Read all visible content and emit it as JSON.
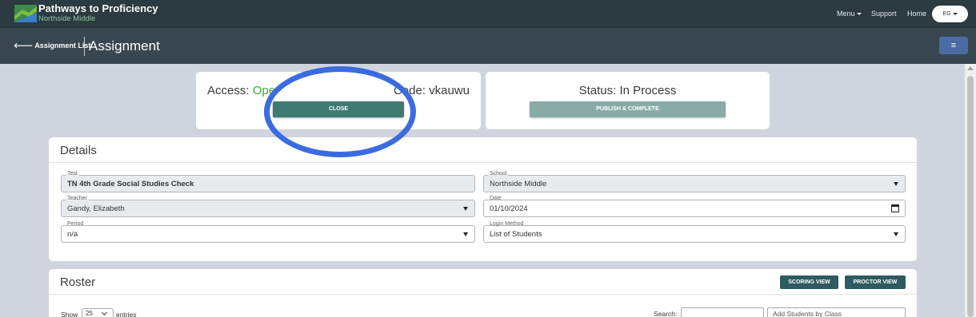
{
  "brand": {
    "title": "Pathways to Proficiency",
    "subtitle": "Northside Middle"
  },
  "topnav": {
    "menu": "Menu",
    "support": "Support",
    "home": "Home",
    "user_initials": "EG"
  },
  "subheader": {
    "back_label": "Assignment List",
    "page_title": "Assignment",
    "menu_icon": "≡"
  },
  "access_card": {
    "access_prefix": "Access: ",
    "access_value": "Ope",
    "code_prefix": "Code: ",
    "code_value": "vkauwu",
    "close_button": "CLOSE"
  },
  "status_card": {
    "status": "Status: In Process",
    "publish_button": "PUBLISH & COMPLETE"
  },
  "details": {
    "title": "Details",
    "fields": {
      "test": {
        "label": "Test",
        "value": "TN 4th Grade Social Studies Check"
      },
      "school": {
        "label": "School",
        "value": "Northside Middle"
      },
      "teacher": {
        "label": "Teacher",
        "value": "Gandy, Elizabeth"
      },
      "date": {
        "label": "Date",
        "value": "01/10/2024"
      },
      "period": {
        "label": "Period",
        "value": "n/a"
      },
      "login_method": {
        "label": "Login Method",
        "value": "List of Students"
      }
    }
  },
  "roster": {
    "title": "Roster",
    "scoring_view": "SCORING VIEW",
    "proctor_view": "PROCTOR VIEW",
    "show_label": "Show",
    "show_value": "25",
    "entries_label": "entries",
    "search_label": "Search:",
    "search_value": "",
    "add_students_placeholder": "Add Students by Class"
  },
  "colors": {
    "topbar": "#2c3a41",
    "subbar": "#38474f",
    "accent_green": "#3aaa3a",
    "close_button": "#3f7a72",
    "annotation_circle": "#3a6ce0"
  }
}
